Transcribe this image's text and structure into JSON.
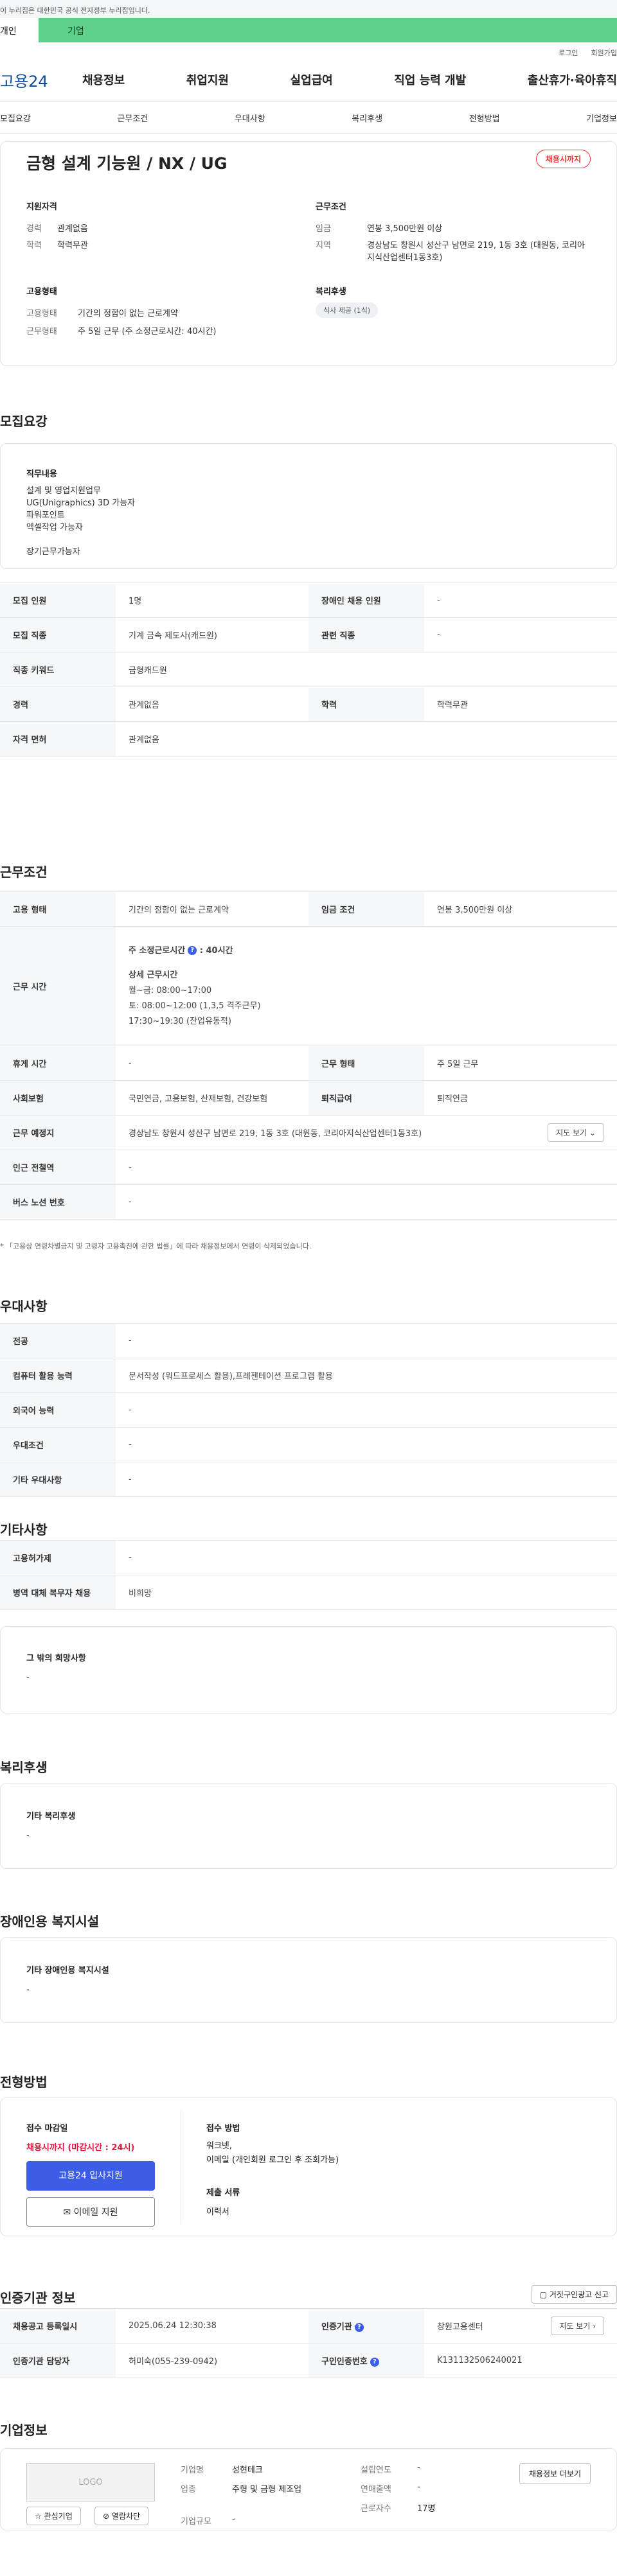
{
  "banner": "이 누리집은 대한민국 공식 전자정부 누리집입니다.",
  "user_tabs": [
    "개인",
    "기업"
  ],
  "util": [
    "로그인",
    "회원가입"
  ],
  "logo": "고용24",
  "gnb": [
    "채용정보",
    "취업지원",
    "실업급여",
    "직업 능력 개발",
    "출산휴가·육아휴직"
  ],
  "lnb": [
    "모집요강",
    "근무조건",
    "우대사항",
    "복리후생",
    "전형방법",
    "기업정보"
  ],
  "summary": {
    "title": "금형 설계 기능원 / NX / UG",
    "status": "채용시까지",
    "qual_title": "지원자격",
    "qual": [
      {
        "k": "경력",
        "v": "관계없음"
      },
      {
        "k": "학력",
        "v": "학력무관"
      }
    ],
    "cond_title": "근무조건",
    "cond": [
      {
        "k": "임금",
        "v": "연봉 3,500만원 이상"
      },
      {
        "k": "지역",
        "v": "경상남도 창원시 성산구 남면로 219, 1동 3호 (대원동, 코리아지식산업센터1동3호)"
      }
    ],
    "emp_title": "고용형태",
    "emp": [
      {
        "k": "고용형태",
        "v": "기간의 정함이 없는 근로계약"
      },
      {
        "k": "근무형태",
        "v": "주 5일 근무 (주 소정근로시간: 40시간)"
      }
    ],
    "welfare_title": "복리후생",
    "welfare_pill": "식사 제공 (1식)"
  },
  "recruit": {
    "title": "모집요강",
    "duty_title": "직무내용",
    "duty_lines": [
      "설계 및 영업지원업무",
      "UG(Unigraphics) 3D 가능자",
      "파워포인트",
      "엑셀작업 가능자",
      "",
      "장기근무가능자"
    ],
    "rows": [
      [
        {
          "h": "모집 인원",
          "v": "1명"
        },
        {
          "h": "장애인 채용 인원",
          "v": "-"
        }
      ],
      [
        {
          "h": "모집 직종",
          "v": "기계 금속 제도사(캐드원)"
        },
        {
          "h": "관련 직종",
          "v": "-"
        }
      ],
      [
        {
          "h": "직종 키워드",
          "v": "금형캐드원"
        }
      ],
      [
        {
          "h": "경력",
          "v": "관계없음"
        },
        {
          "h": "학력",
          "v": "학력무관"
        }
      ],
      [
        {
          "h": "자격 면허",
          "v": "관계없음"
        }
      ]
    ]
  },
  "work": {
    "title": "근무조건",
    "type_h": "고용 형태",
    "type_v": "기간의 정함이 없는 근로계약",
    "wage_h": "임금 조건",
    "wage_v": "연봉 3,500만원 이상",
    "hours_h": "근무 시간",
    "hours_week": "주 소정근로시간",
    "hours_week_val": ": 40시간",
    "hours_detail_title": "상세 근무시간",
    "hours_lines": [
      "월~금: 08:00~17:00",
      "토: 08:00~12:00 (1,3,5 격주근무)",
      "17:30~19:30 (잔업유동적)"
    ],
    "rest_h": "휴게 시간",
    "rest_v": "-",
    "form_h": "근무 형태",
    "form_v": "주 5일 근무",
    "ins_h": "사회보험",
    "ins_v": "국민연금, 고용보험, 산재보험, 건강보험",
    "sev_h": "퇴직급여",
    "sev_v": "퇴직연금",
    "place_h": "근무 예정지",
    "place_v": "경상남도 창원시 성산구 남면로 219, 1동 3호 (대원동, 코리아지식산업센터1동3호)",
    "map_btn": "지도 보기",
    "station_h": "인근 전철역",
    "station_v": "-",
    "bus_h": "버스 노선 번호",
    "bus_v": "-",
    "note": "* 「고용상 연령차별금지 및 고령자 고용촉진에 관한 법률」에 따라 채용정보에서 연령이 삭제되었습니다."
  },
  "prefer": {
    "title": "우대사항",
    "rows": [
      {
        "h": "전공",
        "v": "-"
      },
      {
        "h": "컴퓨터 활용 능력",
        "v": "문서작성 (워드프로세스 활용),프레젠테이션 프로그램 활용"
      },
      {
        "h": "외국어 능력",
        "v": "-"
      },
      {
        "h": "우대조건",
        "v": "-"
      },
      {
        "h": "기타 우대사항",
        "v": "-"
      }
    ]
  },
  "etc": {
    "title": "기타사항",
    "rows": [
      {
        "h": "고용허가제",
        "v": "-"
      },
      {
        "h": "병역 대체 복무자 채용",
        "v": "비희망"
      }
    ],
    "other_title": "그 밖의 희망사항",
    "other_v": "-"
  },
  "welfare": {
    "title": "복리후생",
    "box_title": "기타 복리후생",
    "box_v": "-"
  },
  "disabled": {
    "title": "장애인용 복지시설",
    "box_title": "기타 장애인용 복지시설",
    "box_v": "-"
  },
  "selection": {
    "title": "전형방법",
    "deadline_title": "접수 마감일",
    "deadline_v": "채용시까지 (마감시간 : 24시)",
    "apply_btn": "고용24 입사지원",
    "email_btn": "이메일 지원",
    "method_title": "접수 방법",
    "method_lines": [
      "워크넷,",
      "이메일 (개인회원 로그인 후 조회가능)"
    ],
    "docs_title": "제출 서류",
    "docs_v": "이력서"
  },
  "cert": {
    "title": "인증기관 정보",
    "report_btn": "거짓구인광고 신고",
    "reg_h": "채용공고 등록일시",
    "reg_v": "2025.06.24 12:30:38",
    "org_h": "인증기관",
    "org_v": "창원고용센터",
    "map_btn": "지도 보기",
    "mgr_h": "인증기관 담당자",
    "mgr_v": "허미숙(055-239-0942)",
    "num_h": "구인인증번호",
    "num_v": "K131132506240021"
  },
  "company": {
    "title": "기업정보",
    "logo_text": "LOGO",
    "fav_btn": "관심기업",
    "block_btn": "열람차단",
    "name_k": "기업명",
    "name_v": "성현테크",
    "ind_k": "업종",
    "ind_v": "주형 및 금형 제조업",
    "size_k": "기업규모",
    "size_v": "-",
    "year_k": "설립연도",
    "year_v": "-",
    "sales_k": "연매출액",
    "sales_v": "-",
    "emp_k": "근로자수",
    "emp_v": "17명",
    "more_btn": "채용정보 더보기"
  },
  "colors": {
    "accent": "#3c5ee6",
    "tab_green": "#5fd08b",
    "deadline_red": "#e3163e"
  }
}
